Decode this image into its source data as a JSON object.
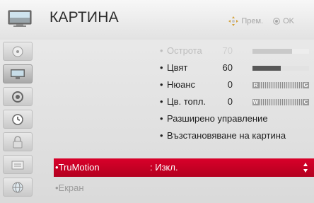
{
  "header": {
    "title": "КАРТИНА",
    "move_hint": "Прем.",
    "ok_hint": "OK"
  },
  "sidebar": {
    "items": [
      {
        "icon": "disc-icon"
      },
      {
        "icon": "picture-icon",
        "selected": true
      },
      {
        "icon": "audio-icon"
      },
      {
        "icon": "clock-icon"
      },
      {
        "icon": "lock-icon"
      },
      {
        "icon": "options-icon"
      },
      {
        "icon": "network-icon"
      }
    ]
  },
  "menu": {
    "sharpness": {
      "label": "Острота",
      "value": "70",
      "level": 0.7
    },
    "color": {
      "label": "Цвят",
      "value": "60",
      "level": 0.5
    },
    "tint": {
      "label": "Нюанс",
      "value": "0",
      "start": "R",
      "end": "G"
    },
    "color_temp": {
      "label": "Цв. топл.",
      "value": "0",
      "start": "W",
      "end": "C"
    },
    "advanced": {
      "label": "Разширено управление"
    },
    "reset": {
      "label": "Възстановяване на картина"
    },
    "trumotion": {
      "label": "TruMotion",
      "value": ": Изкл."
    },
    "screen": {
      "label": "Екран"
    }
  },
  "colors": {
    "highlight": "#c4002a",
    "header_bg": "#f0f0f0"
  }
}
